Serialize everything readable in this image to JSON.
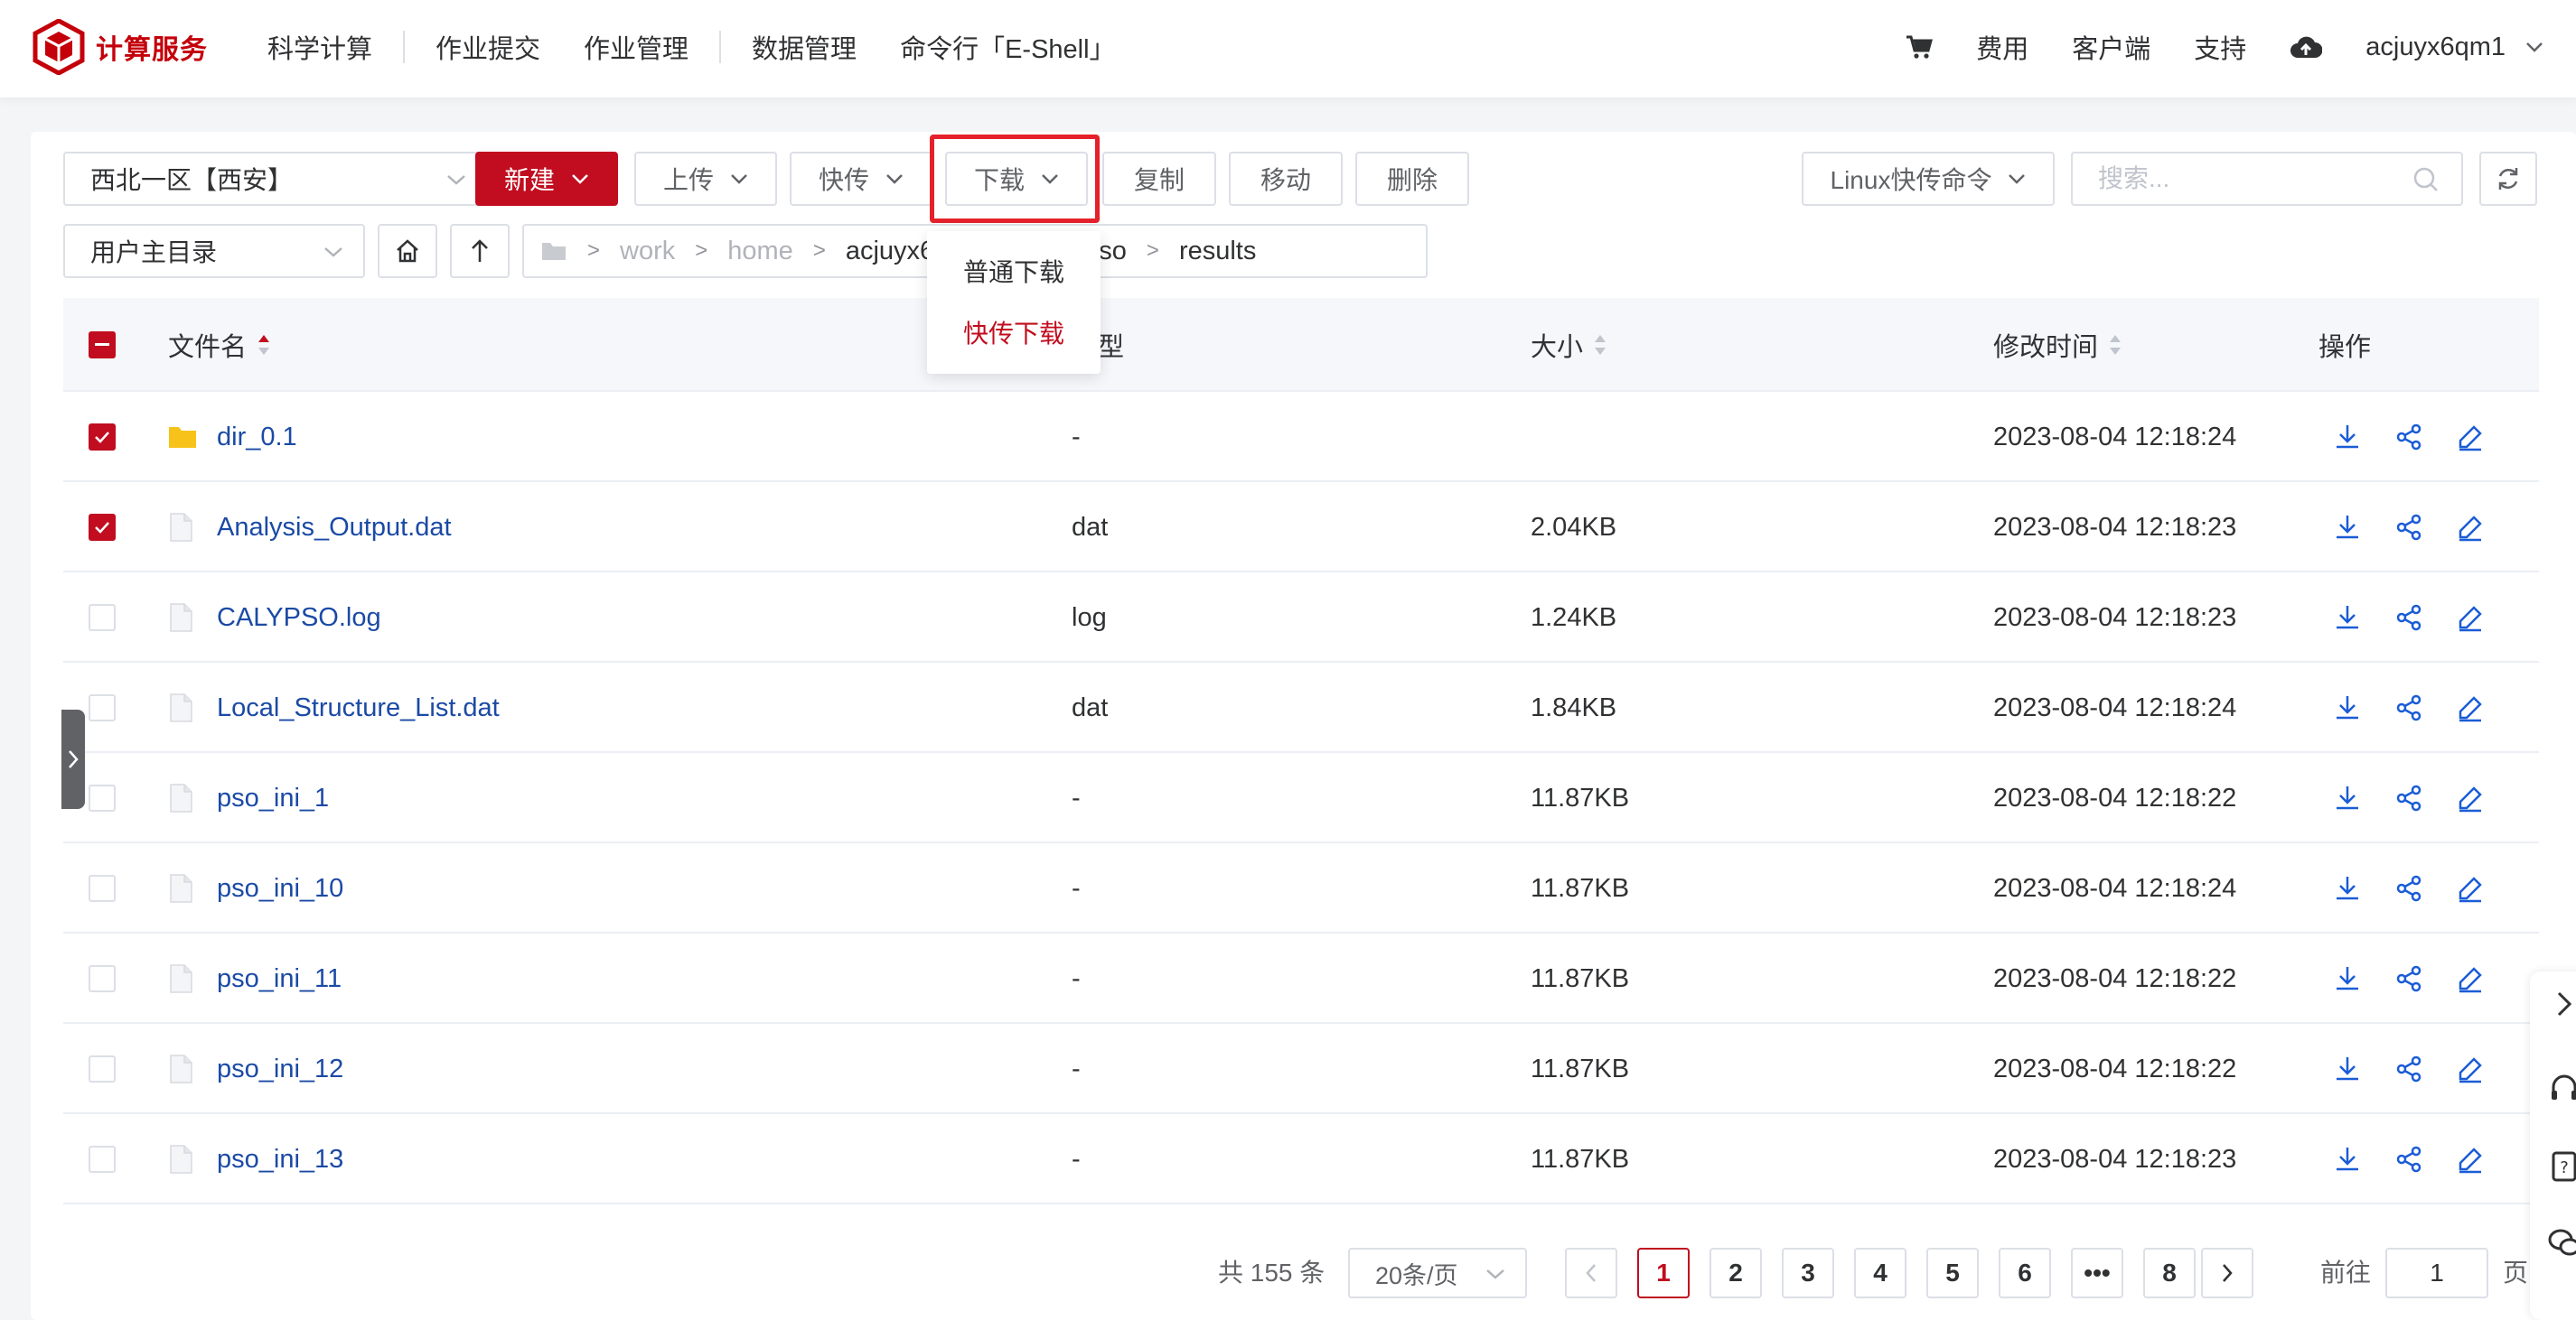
{
  "brand": {
    "name": "计算服务",
    "color": "#c4000a"
  },
  "nav": [
    "科学计算",
    "作业提交",
    "作业管理",
    "数据管理",
    "命令行「E-Shell」"
  ],
  "header_right": {
    "cart_icon": "cart-icon",
    "fee": "费用",
    "client": "客户端",
    "support": "支持",
    "cloud_icon": "cloud-upload-icon",
    "username": "acjuyx6qm1"
  },
  "toolbar": {
    "region": "西北一区【西安】",
    "new_label": "新建",
    "upload_label": "上传",
    "fast_transfer_label": "快传",
    "download_label": "下载",
    "copy_label": "复制",
    "move_label": "移动",
    "delete_label": "删除",
    "linux_cmd_label": "Linux快传命令",
    "search_placeholder": "搜索..."
  },
  "download_menu": [
    "普通下载",
    "快传下载"
  ],
  "path_bar": {
    "root_select": "用户主目录",
    "crumbs": [
      "work",
      "home",
      "acjuyx6qm1",
      "calypso",
      "results"
    ]
  },
  "table": {
    "columns": {
      "name": "文件名",
      "type": "类型",
      "size": "大小",
      "mtime": "修改时间",
      "ops": "操作"
    },
    "rows": [
      {
        "name": "dir_0.1",
        "type": "-",
        "size": "",
        "mtime": "2023-08-04 12:18:24",
        "kind": "folder",
        "checked": true
      },
      {
        "name": "Analysis_Output.dat",
        "type": "dat",
        "size": "2.04KB",
        "mtime": "2023-08-04 12:18:23",
        "kind": "file",
        "checked": true
      },
      {
        "name": "CALYPSO.log",
        "type": "log",
        "size": "1.24KB",
        "mtime": "2023-08-04 12:18:23",
        "kind": "file",
        "checked": false
      },
      {
        "name": "Local_Structure_List.dat",
        "type": "dat",
        "size": "1.84KB",
        "mtime": "2023-08-04 12:18:24",
        "kind": "file",
        "checked": false
      },
      {
        "name": "pso_ini_1",
        "type": "-",
        "size": "11.87KB",
        "mtime": "2023-08-04 12:18:22",
        "kind": "file",
        "checked": false
      },
      {
        "name": "pso_ini_10",
        "type": "-",
        "size": "11.87KB",
        "mtime": "2023-08-04 12:18:24",
        "kind": "file",
        "checked": false
      },
      {
        "name": "pso_ini_11",
        "type": "-",
        "size": "11.87KB",
        "mtime": "2023-08-04 12:18:22",
        "kind": "file",
        "checked": false
      },
      {
        "name": "pso_ini_12",
        "type": "-",
        "size": "11.87KB",
        "mtime": "2023-08-04 12:18:22",
        "kind": "file",
        "checked": false
      },
      {
        "name": "pso_ini_13",
        "type": "-",
        "size": "11.87KB",
        "mtime": "2023-08-04 12:18:23",
        "kind": "file",
        "checked": false
      }
    ]
  },
  "pagination": {
    "total": "共 155 条",
    "page_size": "20条/页",
    "pages": [
      "1",
      "2",
      "3",
      "4",
      "5",
      "6",
      "•••",
      "8"
    ],
    "current": "1",
    "goto_prefix": "前往",
    "goto_value": "1",
    "goto_suffix": "页"
  },
  "colors": {
    "accent": "#c10d1f",
    "link": "#1b4aa5",
    "folder": "#f7c21a",
    "op_icon": "#1a5cd6"
  }
}
